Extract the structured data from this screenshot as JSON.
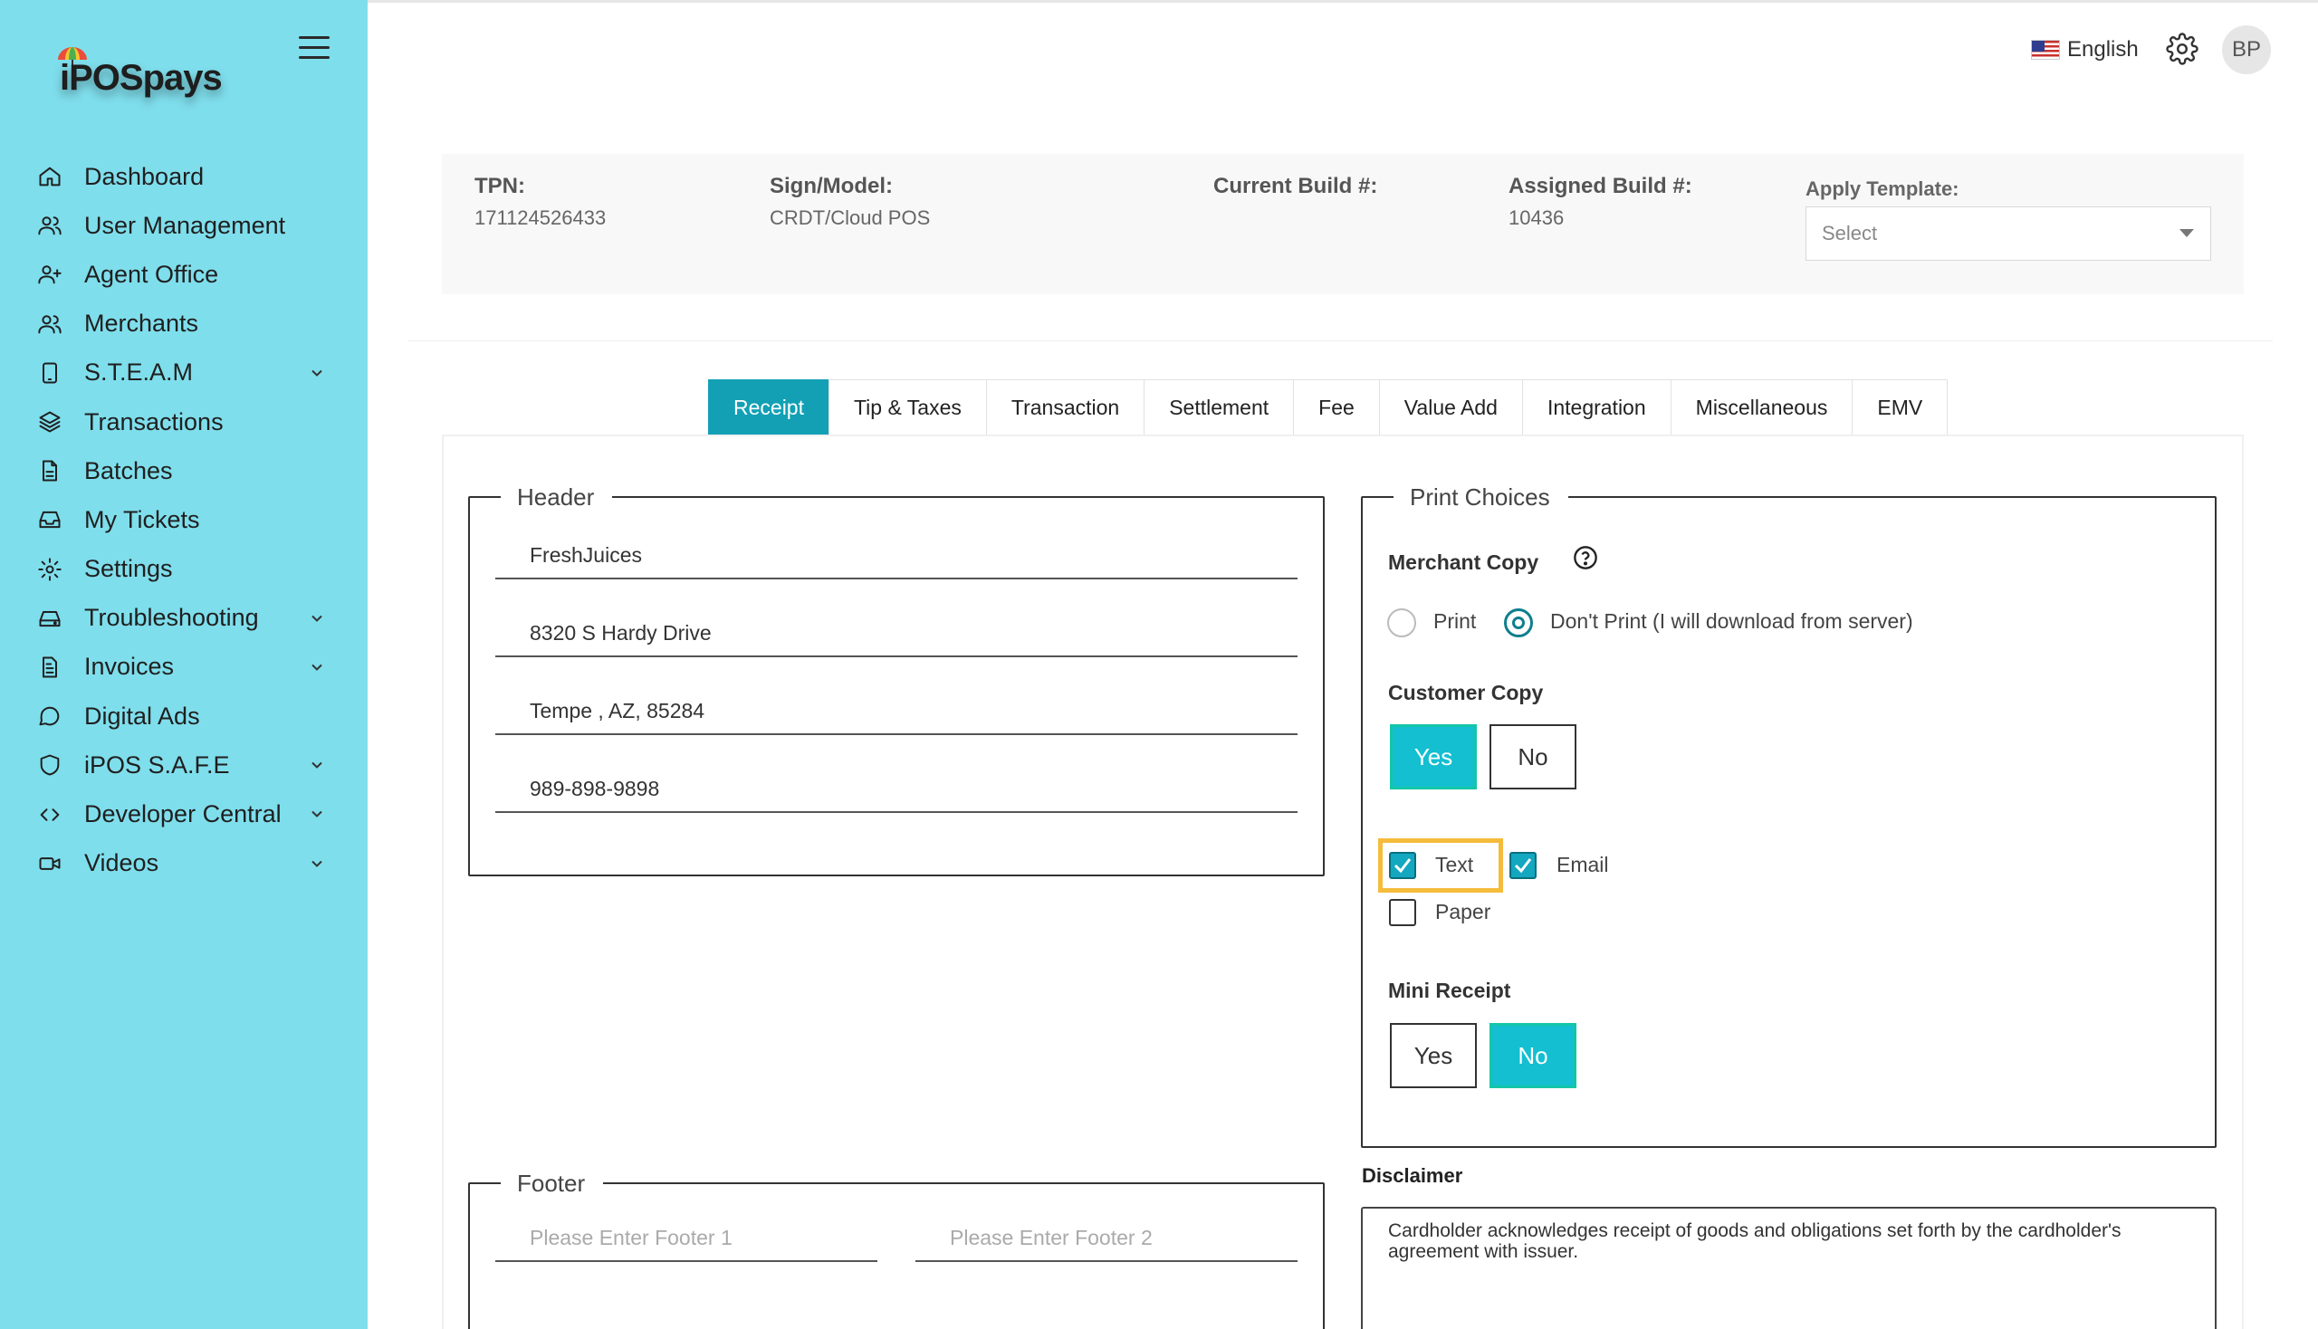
{
  "brand": {
    "logo_text": "iPOSpays"
  },
  "sidebar": {
    "items": [
      {
        "label": "Dashboard",
        "icon": "home-icon",
        "expandable": false
      },
      {
        "label": "User Management",
        "icon": "users-icon",
        "expandable": false
      },
      {
        "label": "Agent Office",
        "icon": "user-plus-icon",
        "expandable": false
      },
      {
        "label": "Merchants",
        "icon": "users-icon",
        "expandable": false
      },
      {
        "label": "S.T.E.A.M",
        "icon": "device-icon",
        "expandable": true
      },
      {
        "label": "Transactions",
        "icon": "layers-icon",
        "expandable": false
      },
      {
        "label": "Batches",
        "icon": "file-icon",
        "expandable": false
      },
      {
        "label": "My Tickets",
        "icon": "inbox-icon",
        "expandable": false
      },
      {
        "label": "Settings",
        "icon": "gear-icon",
        "expandable": false
      },
      {
        "label": "Troubleshooting",
        "icon": "drive-icon",
        "expandable": true
      },
      {
        "label": "Invoices",
        "icon": "document-icon",
        "expandable": true
      },
      {
        "label": "Digital Ads",
        "icon": "chat-bubble-icon",
        "expandable": false
      },
      {
        "label": "iPOS S.A.F.E",
        "icon": "shield-icon",
        "expandable": true
      },
      {
        "label": "Developer Central",
        "icon": "code-icon",
        "expandable": true
      },
      {
        "label": "Videos",
        "icon": "video-icon",
        "expandable": true
      }
    ]
  },
  "topbar": {
    "language": "English",
    "avatar_initials": "BP"
  },
  "info": {
    "tpn_label": "TPN:",
    "tpn_value": "171124526433",
    "model_label": "Sign/Model:",
    "model_value": "CRDT/Cloud POS",
    "current_build_label": "Current Build #:",
    "current_build_value": "",
    "assigned_build_label": "Assigned Build #:",
    "assigned_build_value": "10436",
    "apply_template_label": "Apply Template:",
    "apply_template_value": "Select"
  },
  "tabs": [
    "Receipt",
    "Tip & Taxes",
    "Transaction",
    "Settlement",
    "Fee",
    "Value Add",
    "Integration",
    "Miscellaneous",
    "EMV"
  ],
  "active_tab": "Receipt",
  "header_section": {
    "legend": "Header",
    "lines": [
      "FreshJuices",
      "8320 S Hardy Drive",
      "Tempe , AZ, 85284",
      "989-898-9898"
    ]
  },
  "footer_section": {
    "legend": "Footer",
    "footer1_placeholder": "Please Enter Footer 1",
    "footer2_placeholder": "Please Enter Footer 2"
  },
  "print_choices": {
    "legend": "Print Choices",
    "merchant_copy_label": "Merchant Copy",
    "merchant_print_label": "Print",
    "merchant_dont_print_label": "Don't Print (I will download from server)",
    "merchant_selected": "dont_print",
    "customer_copy_label": "Customer Copy",
    "yes_label": "Yes",
    "no_label": "No",
    "customer_copy_value": "Yes",
    "text_label": "Text",
    "text_checked": true,
    "email_label": "Email",
    "email_checked": true,
    "paper_label": "Paper",
    "paper_checked": false,
    "mini_receipt_label": "Mini Receipt",
    "mini_receipt_value": "No"
  },
  "disclaimer": {
    "title": "Disclaimer",
    "text": "Cardholder acknowledges receipt of goods and obligations set forth by the cardholder's agreement with issuer."
  },
  "colors": {
    "sidebar": "#7fdeec",
    "accent": "#13a0b4",
    "highlight": "#f5bc3c"
  }
}
